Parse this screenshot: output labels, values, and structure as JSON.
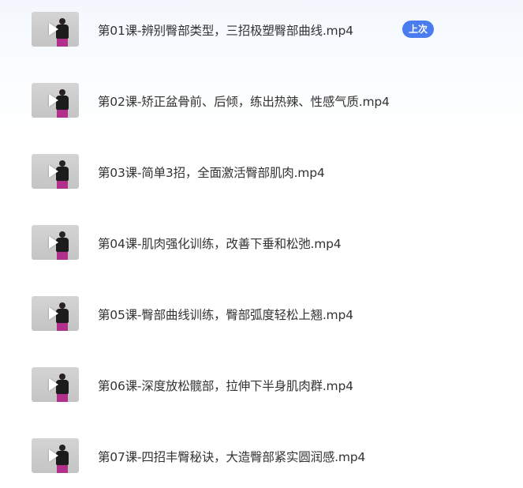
{
  "lessons": [
    {
      "title": "第01课-辨别臀部类型，三招极塑臀部曲线.mp4",
      "badge": "上次"
    },
    {
      "title": "第02课-矫正盆骨前、后倾，练出热辣、性感气质.mp4"
    },
    {
      "title": "第03课-简单3招，全面激活臀部肌肉.mp4"
    },
    {
      "title": "第04课-肌肉强化训练，改善下垂和松弛.mp4"
    },
    {
      "title": "第05课-臀部曲线训练，臀部弧度轻松上翘.mp4"
    },
    {
      "title": "第06课-深度放松髋部，拉伸下半身肌肉群.mp4"
    },
    {
      "title": "第07课-四招丰臀秘诀，大造臀部紧实圆润感.mp4"
    }
  ],
  "colors": {
    "badge_bg": "#4a7cf0",
    "title_text": "#333333",
    "thumbnail_bg": "#c8c8c8"
  },
  "icons": {
    "play": "play-icon"
  }
}
